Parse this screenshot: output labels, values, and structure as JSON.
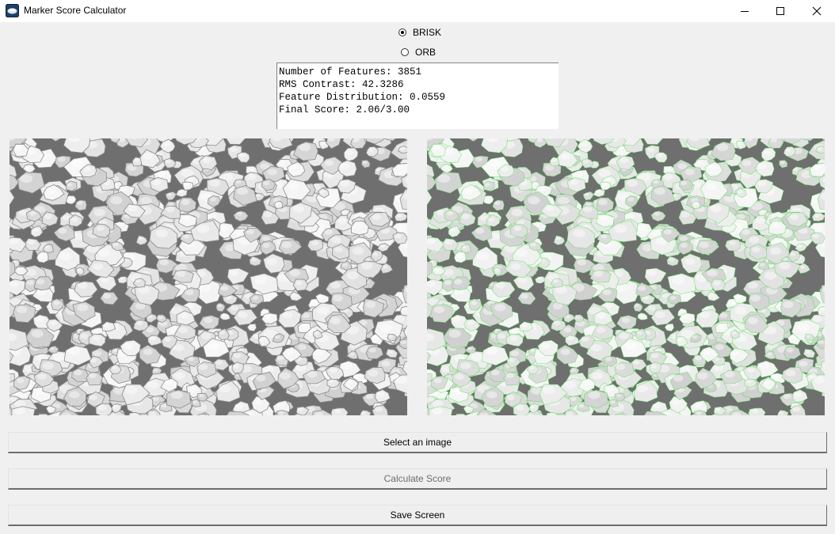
{
  "window": {
    "title": "Marker Score Calculator",
    "icon": "app-icon"
  },
  "detector": {
    "options": [
      "BRISK",
      "ORB"
    ],
    "selected": "BRISK"
  },
  "output": {
    "lines": [
      "Number of Features: 3851",
      "RMS Contrast: 42.3286",
      "Feature Distribution: 0.0559",
      "Final Score: 2.06/3.00"
    ]
  },
  "images": {
    "feature_color": "#22dd22"
  },
  "buttons": {
    "select_label": "Select an image",
    "calculate_label": "Calculate Score",
    "calculate_enabled": false,
    "save_label": "Save Screen"
  }
}
